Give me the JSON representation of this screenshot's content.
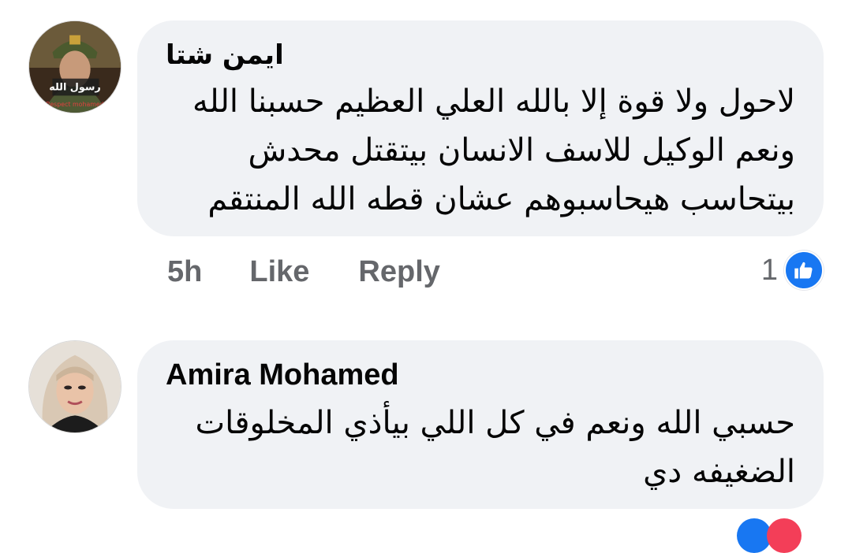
{
  "comments": [
    {
      "author": "ايمن شتا",
      "text": "لاحول ولا قوة إلا بالله العلي العظيم حسبنا الله\nونعم الوكيل للاسف الانسان بيتقتل محدش\nبيتحاسب هيحاسبوهم عشان قطه الله المنتقم",
      "avatar_caption": "رسول الله",
      "avatar_subcaption": "Respect mohamed",
      "time": "5h",
      "like_label": "Like",
      "reply_label": "Reply",
      "reaction_count": "1",
      "reaction_icon": "thumbs-up-icon"
    },
    {
      "author": "Amira Mohamed",
      "text": "حسبي الله ونعم في كل اللي بيأذي المخلوقات\nالضغيفه دي"
    }
  ],
  "colors": {
    "bubble": "#f0f2f5",
    "meta_text": "#65676b",
    "like_blue": "#1877f2",
    "love_red": "#f33e58"
  }
}
